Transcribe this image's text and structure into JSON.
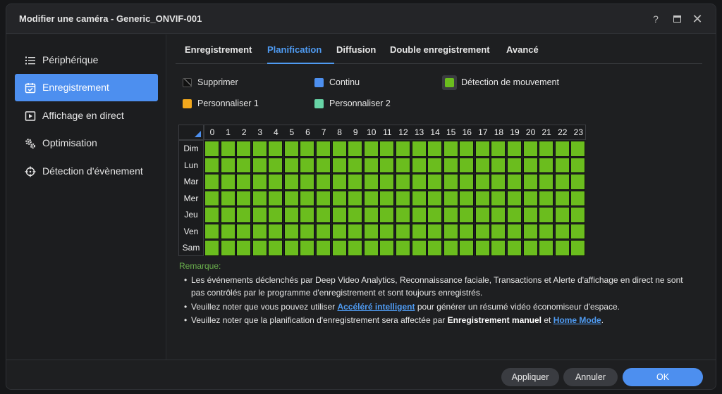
{
  "window": {
    "title": "Modifier une caméra - Generic_ONVIF-001",
    "help_glyph": "?",
    "close_glyph": "✕"
  },
  "sidebar": {
    "items": [
      {
        "label": "Périphérique",
        "icon": "list-icon",
        "active": false
      },
      {
        "label": "Enregistrement",
        "icon": "calendar-check-icon",
        "active": true
      },
      {
        "label": "Affichage en direct",
        "icon": "play-square-icon",
        "active": false
      },
      {
        "label": "Optimisation",
        "icon": "gears-icon",
        "active": false
      },
      {
        "label": "Détection d'évènement",
        "icon": "crosshair-icon",
        "active": false
      }
    ]
  },
  "tabs": [
    {
      "label": "Enregistrement",
      "active": false
    },
    {
      "label": "Planification",
      "active": true
    },
    {
      "label": "Diffusion",
      "active": false
    },
    {
      "label": "Double enregistrement",
      "active": false
    },
    {
      "label": "Avancé",
      "active": false
    }
  ],
  "legend": {
    "delete": {
      "label": "Supprimer",
      "color": "#111111"
    },
    "continuous": {
      "label": "Continu",
      "color": "#4d8fef"
    },
    "motion": {
      "label": "Détection de mouvement",
      "color": "#6bbd1e",
      "selected": true
    },
    "custom1": {
      "label": "Personnaliser 1",
      "color": "#f2a81d"
    },
    "custom2": {
      "label": "Personnaliser 2",
      "color": "#67d4a6"
    }
  },
  "schedule": {
    "hours": [
      "0",
      "1",
      "2",
      "3",
      "4",
      "5",
      "6",
      "7",
      "8",
      "9",
      "10",
      "11",
      "12",
      "13",
      "14",
      "15",
      "16",
      "17",
      "18",
      "19",
      "20",
      "21",
      "22",
      "23"
    ],
    "days": [
      "Dim",
      "Lun",
      "Mar",
      "Mer",
      "Jeu",
      "Ven",
      "Sam"
    ],
    "fill_mode": "motion",
    "cell_color": "#6bbd1e"
  },
  "remark": {
    "title": "Remarque:",
    "line1": "Les événements déclenchés par Deep Video Analytics, Reconnaissance faciale, Transactions et Alerte d'affichage en direct ne sont pas contrôlés par le programme d'enregistrement et sont toujours enregistrés.",
    "line2_pre": "Veuillez noter que vous pouvez utiliser ",
    "line2_link": "Accéléré intelligent",
    "line2_post": " pour générer un résumé vidéo économiseur d'espace.",
    "line3_pre": "Veuillez noter que la planification d'enregistrement sera affectée par ",
    "line3_strong": "Enregistrement manuel",
    "line3_mid": " et ",
    "line3_link": "Home Mode",
    "line3_post": ".",
    "bullet": "•"
  },
  "footer": {
    "apply": "Appliquer",
    "cancel": "Annuler",
    "ok": "OK"
  }
}
